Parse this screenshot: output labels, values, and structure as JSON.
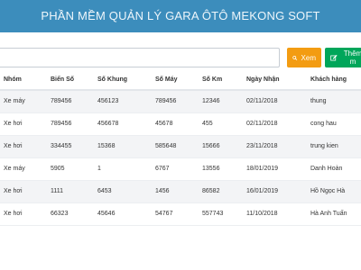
{
  "app": {
    "title": "PHẦN MỀM QUẢN LÝ GARA ÔTÔ MEKONG SOFT"
  },
  "toolbar": {
    "search_placeholder": "",
    "search_button_label": "Xem",
    "add_button_label": "Thêm m",
    "colors": {
      "search": "#f39c12",
      "add": "#00a65a",
      "header": "#3c8dbc"
    }
  },
  "table": {
    "columns": [
      "Nhóm",
      "Biển Số",
      "Số Khung",
      "Số Máy",
      "Số Km",
      "Ngày Nhận",
      "Khách hàng"
    ],
    "rows": [
      [
        "Xe máy",
        "789456",
        "456123",
        "789456",
        "12346",
        "02/11/2018",
        "thung"
      ],
      [
        "Xe hơi",
        "789456",
        "456678",
        "45678",
        "455",
        "02/11/2018",
        "cong hau"
      ],
      [
        "Xe hơi",
        "334455",
        "15368",
        "585648",
        "15666",
        "23/11/2018",
        "trung kien"
      ],
      [
        "Xe máy",
        "5905",
        "1",
        "6767",
        "13556",
        "18/01/2019",
        "Danh Hoàn"
      ],
      [
        "Xe hơi",
        "1111",
        "6453",
        "1456",
        "86582",
        "16/01/2019",
        "Hồ Ngọc Hà"
      ],
      [
        "Xe hơi",
        "66323",
        "45646",
        "54767",
        "557743",
        "11/10/2018",
        "Hà Anh Tuấn"
      ]
    ]
  }
}
